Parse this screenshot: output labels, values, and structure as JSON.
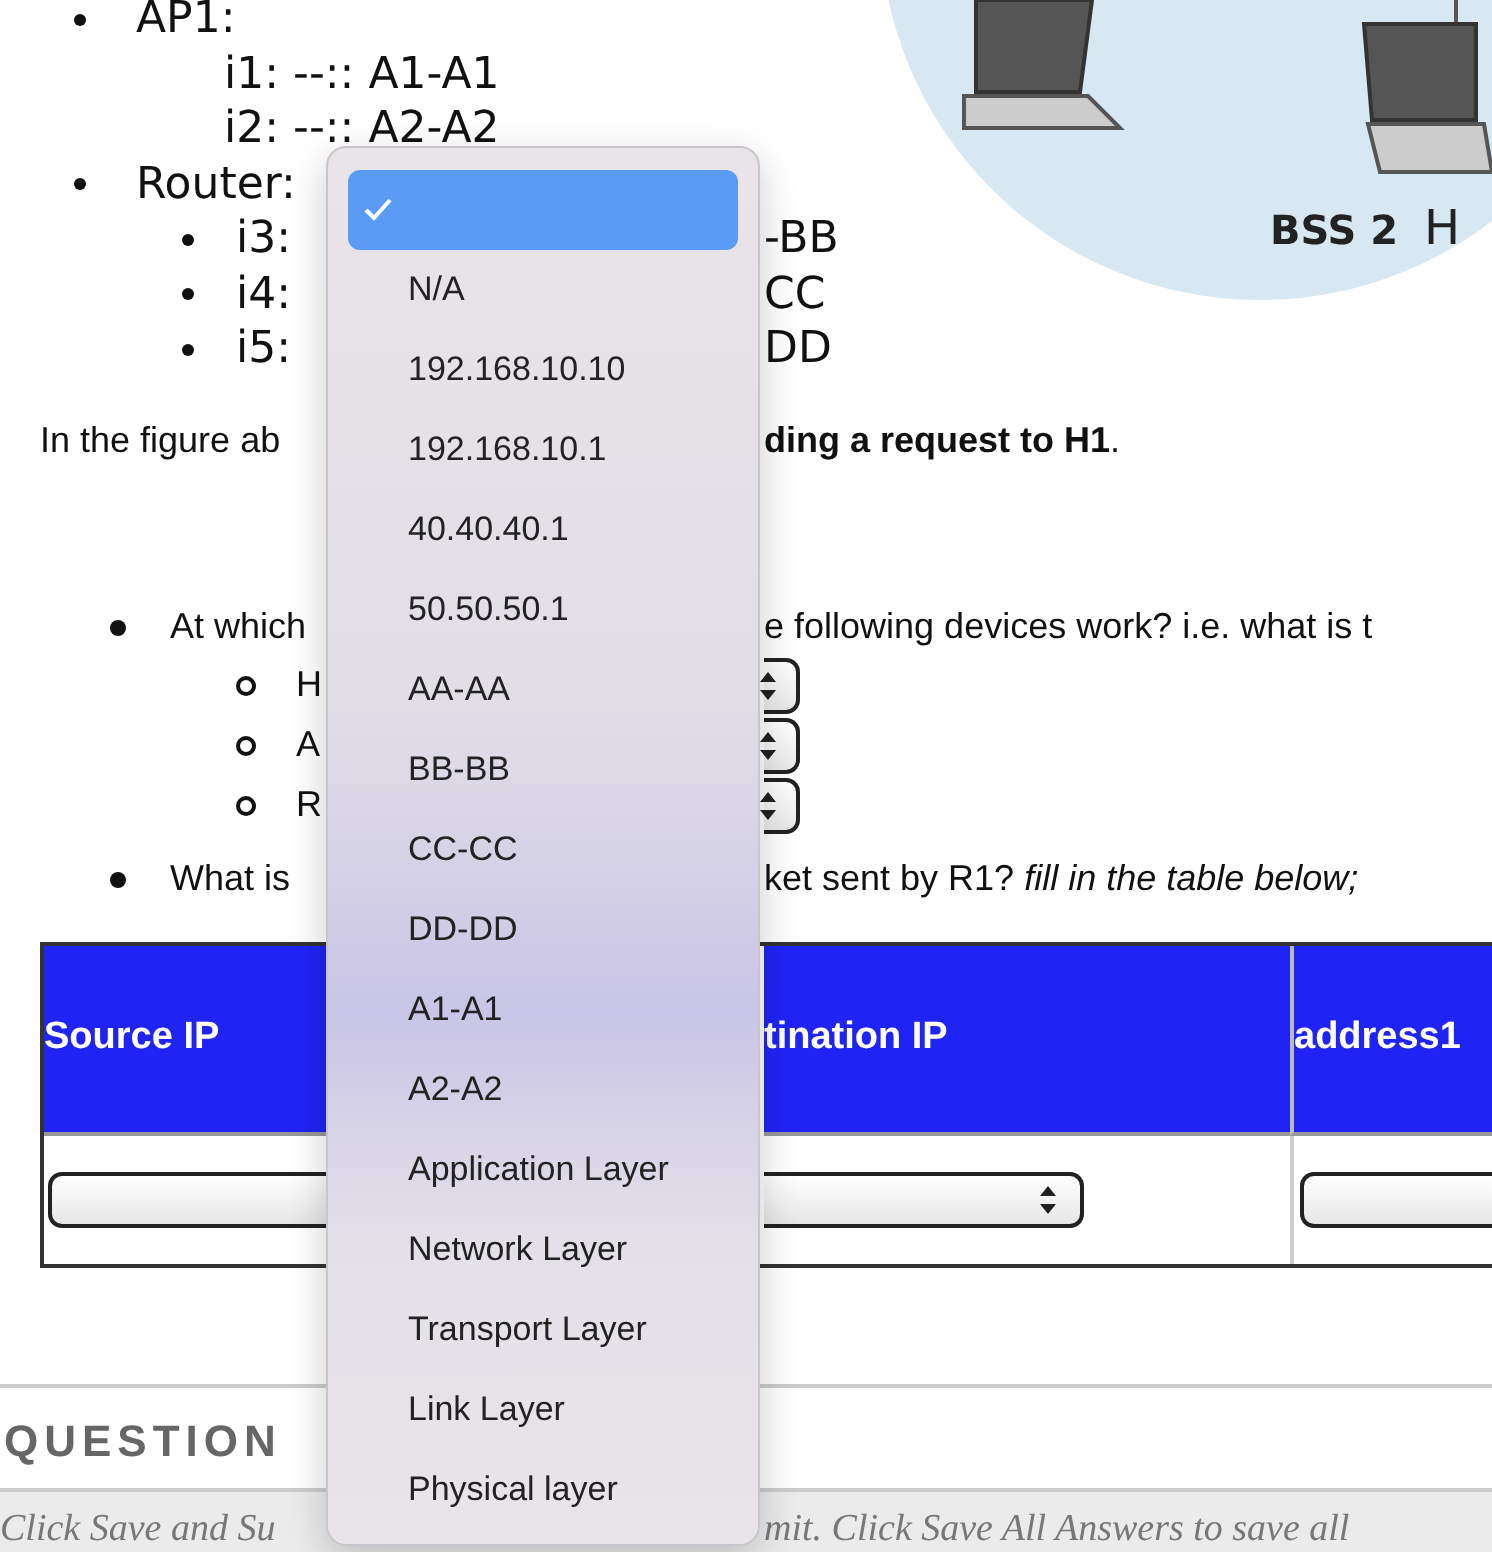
{
  "figure": {
    "labels": [
      "BSS 2",
      "H"
    ]
  },
  "outline": [
    {
      "left": "AP1:",
      "children": [
        {
          "left": "i1: --:: A1-A1"
        },
        {
          "left": "i2: --:: A2-A2"
        }
      ]
    },
    {
      "left": "Router:",
      "children": [
        {
          "left": "i3:",
          "right": "-BB"
        },
        {
          "left": "i4:",
          "right": "CC"
        },
        {
          "left": "i5:",
          "right": "DD"
        }
      ]
    }
  ],
  "sentence": {
    "left": "In the figure ab",
    "right": "**ding a request to H1**."
  },
  "questions": [
    {
      "left": "At which",
      "right": "e following devices work? i.e. what is t",
      "children": [
        {
          "left": "H"
        },
        {
          "left": "A"
        },
        {
          "left": "R"
        }
      ]
    },
    {
      "left": "What is",
      "right": "ket sent by R1? *fill in the table below;*"
    }
  ],
  "table": {
    "columns": [
      "Source IP",
      "tination IP",
      "address1"
    ]
  },
  "question_heading": "QUESTION",
  "footer": {
    "left": "Click Save and Su",
    "right": "mit. Click Save All Answers to save all"
  },
  "menu": {
    "items": [
      {
        "selected": true
      },
      {
        "label": "N/A",
        "selected": false
      },
      {
        "label": "192.168.10.10",
        "selected": false
      },
      {
        "label": "192.168.10.1",
        "selected": false
      },
      {
        "label": "40.40.40.1",
        "selected": false
      },
      {
        "label": "50.50.50.1",
        "selected": false
      },
      {
        "label": "AA-AA",
        "selected": false
      },
      {
        "label": "BB-BB",
        "selected": false
      },
      {
        "label": "CC-CC",
        "selected": false
      },
      {
        "label": "DD-DD",
        "selected": false
      },
      {
        "label": "A1-A1",
        "selected": false
      },
      {
        "label": "A2-A2",
        "selected": false
      },
      {
        "label": "Application Layer",
        "selected": false
      },
      {
        "label": "Network Layer",
        "selected": false
      },
      {
        "label": "Transport Layer",
        "selected": false
      },
      {
        "label": "Link Layer",
        "selected": false
      },
      {
        "label": "Physical layer",
        "selected": false
      }
    ]
  }
}
